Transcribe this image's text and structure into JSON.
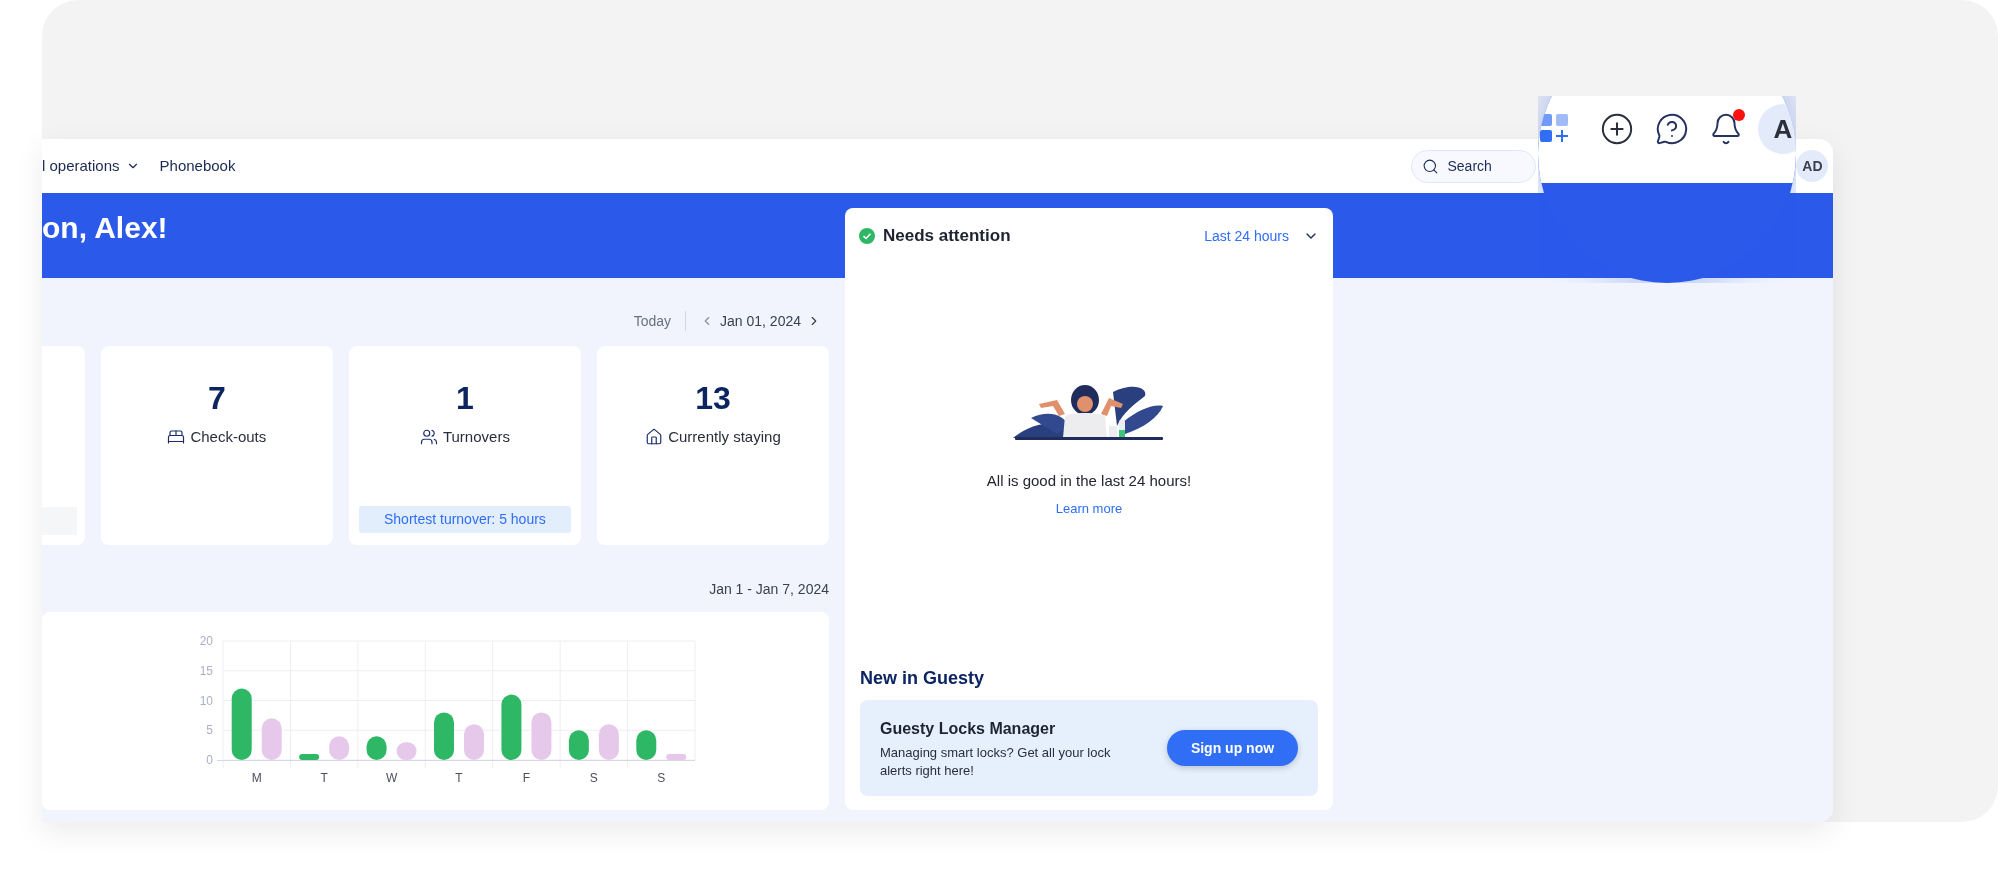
{
  "nav": {
    "items": [
      {
        "label": "l operations",
        "has_menu": true
      },
      {
        "label": "Phonebook",
        "has_menu": false
      }
    ]
  },
  "search": {
    "placeholder": "Search"
  },
  "user_avatar": {
    "initials": "AD"
  },
  "greeting": "on, Alex!",
  "date_nav": {
    "today": "Today",
    "date": "Jan 01, 2024"
  },
  "stat_cards": [
    {
      "kind": "checkouts",
      "value": "7",
      "label": "Check-outs"
    },
    {
      "kind": "turnovers",
      "value": "1",
      "label": "Turnovers",
      "note": "Shortest turnover: 5 hours"
    },
    {
      "kind": "staying",
      "value": "13",
      "label": "Currently staying"
    }
  ],
  "week_range": "Jan 1 - Jan 7, 2024",
  "chart_data": {
    "type": "bar",
    "categories": [
      "M",
      "T",
      "W",
      "T",
      "F",
      "S",
      "S"
    ],
    "series": [
      {
        "color": "#2eb866",
        "values": [
          12,
          1,
          4,
          8,
          11,
          5,
          5
        ]
      },
      {
        "color": "#e6c8ea",
        "values": [
          7,
          4,
          3,
          6,
          8,
          6,
          1
        ]
      }
    ],
    "ylim": [
      0,
      20
    ],
    "yticks": [
      0,
      5,
      10,
      15,
      20
    ],
    "grid": true
  },
  "attention": {
    "title": "Needs attention",
    "period": "Last 24 hours",
    "message": "All is good in the last 24 hours!",
    "link": "Learn more"
  },
  "news": {
    "title": "New in Guesty",
    "promo": {
      "title": "Guesty Locks Manager",
      "text": "Managing smart locks? Get all your lock alerts right here!",
      "button": "Sign up now"
    }
  },
  "magnifier": {
    "avatar_initial": "A",
    "notifications_unread": true
  }
}
